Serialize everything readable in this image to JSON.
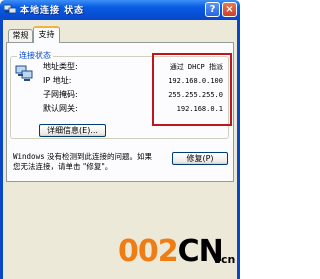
{
  "window": {
    "title": "本地连接 状态",
    "help_label": "?",
    "close_label": "×"
  },
  "tabs": [
    {
      "label": "常规",
      "active": false
    },
    {
      "label": "支持",
      "active": true
    }
  ],
  "group": {
    "legend": "连接状态",
    "rows": [
      {
        "label": "地址类型:",
        "value": "通过 DHCP 指派"
      },
      {
        "label": "IP 地址:",
        "value": "192.168.0.100"
      },
      {
        "label": "子网掩码:",
        "value": "255.255.255.0"
      },
      {
        "label": "默认网关:",
        "value": "192.168.0.1"
      }
    ],
    "details_button": "详细信息(E)..."
  },
  "message": {
    "line1_prefix": "Windows",
    "line1_rest": " 没有检测到此连接的问题。如果",
    "line2": "您无法连接，请单击 \"修复\"。"
  },
  "repair_button": "修复(P)",
  "watermark": {
    "text": "002",
    "text_cn": "CN",
    "suffix": "cn"
  },
  "colors": {
    "titlebar": "#0a5de2",
    "highlight_box": "#c0151b",
    "logo_orange": "#f07c14"
  },
  "icons": {
    "title": "network-connection-icon",
    "status": "network-status-icon"
  }
}
